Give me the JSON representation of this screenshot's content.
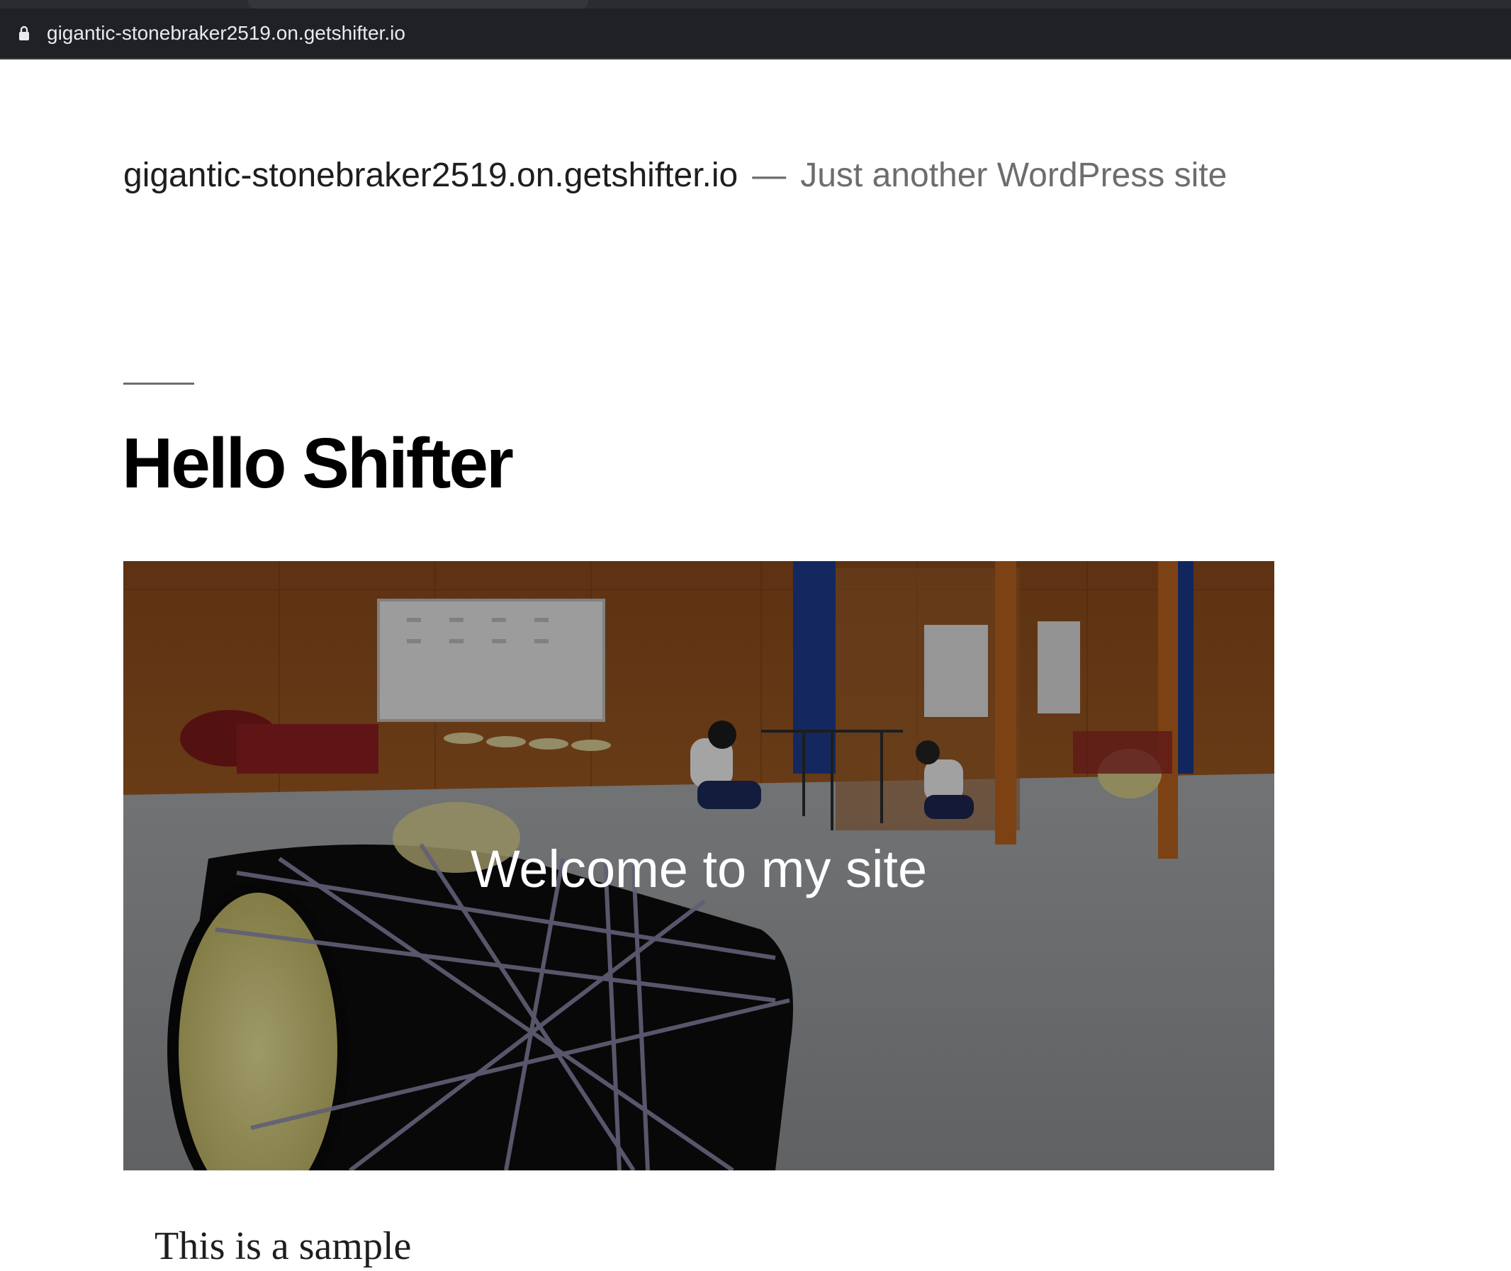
{
  "browser": {
    "url": "gigantic-stonebraker2519.on.getshifter.io",
    "lock_icon": "lock-icon"
  },
  "site": {
    "title": "gigantic-stonebraker2519.on.getshifter.io",
    "separator": "—",
    "description": "Just another WordPress site"
  },
  "post": {
    "title": "Hello Shifter",
    "cover_text": "Welcome to my site",
    "content_start": "This is a sample"
  },
  "colors": {
    "browser_bar": "#202124",
    "text_primary": "#000000",
    "text_secondary": "#6d6d6d"
  }
}
